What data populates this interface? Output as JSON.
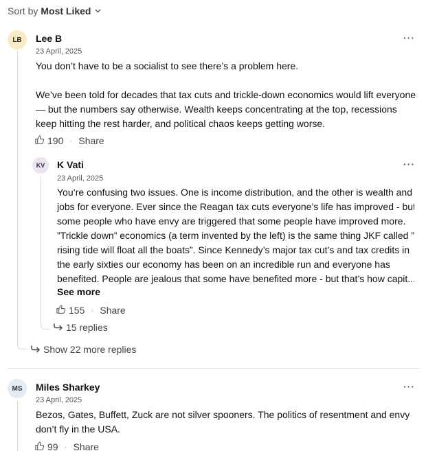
{
  "sort": {
    "prefix": "Sort by",
    "value": "Most Liked"
  },
  "comments": [
    {
      "initials": "LB",
      "avatar_color": "#f7ecc3",
      "author": "Lee B",
      "date": "23 April, 2025",
      "paragraphs": [
        "You don’t have to be a socialist to see there’s a problem here.",
        " We’ve been told for decades that tax cuts and trickle-down economics would lift everyone— but the numbers say otherwise. Wealth keeps concentrating at the top, recessions keep hitting the rest harder, and political chaos keeps getting worse."
      ],
      "likes": "190",
      "share_label": "Share",
      "reply": {
        "initials": "KV",
        "avatar_color": "#ece3f3",
        "author": "K Vati",
        "date": "23 April, 2025",
        "lines": [
          "You’re confusing two issues.   One is income distribution, and the other is wealth and",
          "jobs for everyone.   Ever since the Reagan tax cuts everyone’s life has improved - but",
          "some people who have envy are triggered that some people have improved more.",
          "”Trickle down” economics (a term invented by the left) is the same thing JKF called ”a",
          "rising tide will float all the boats”.   Since Kennedy’s major tax cut’s and tax credits in",
          "the early sixties our economy has been on an incredible run and everyone has",
          "benefited.   People are jealous that some have benefited more - but that’s how capit..."
        ],
        "see_more": "See more",
        "likes": "155",
        "share_label": "Share",
        "replies_label": "15 replies"
      },
      "more_replies_label": "Show 22 more replies"
    },
    {
      "initials": "MS",
      "avatar_color": "#e2ecf2",
      "author": "Miles Sharkey",
      "date": "23 April, 2025",
      "lines": [
        "Bezos, Gates, Buffett, Zuck are not silver spooners. The politics of resentment and envy",
        "don’t fly in the USA."
      ],
      "likes": "99",
      "share_label": "Share"
    }
  ],
  "icons": {
    "like": "thumbs-up-icon",
    "reply_arrow": "reply-arrow-icon",
    "more": "more-options-icon",
    "chevron": "chevron-down-icon"
  }
}
